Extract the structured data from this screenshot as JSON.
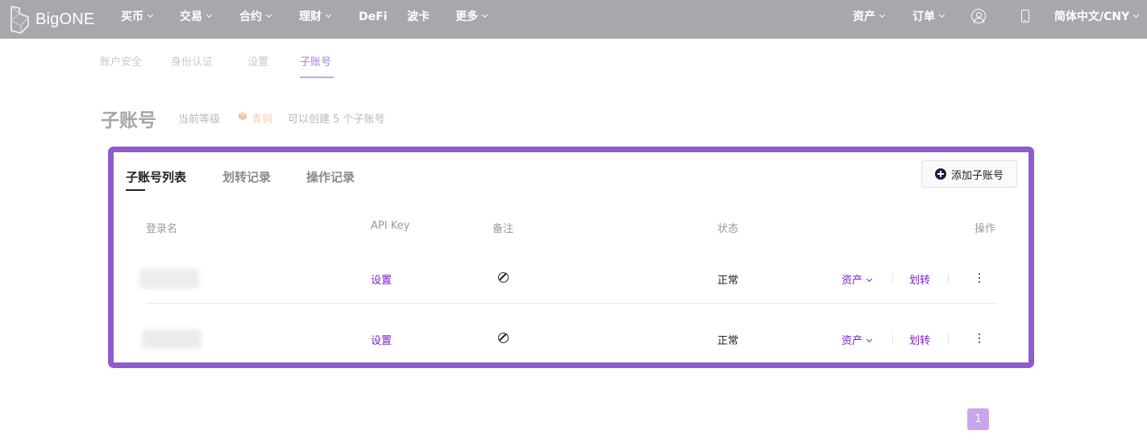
{
  "brand": {
    "name": "BigONE"
  },
  "topnav": {
    "left": [
      {
        "label": "买币",
        "dropdown": true
      },
      {
        "label": "交易",
        "dropdown": true
      },
      {
        "label": "合约",
        "dropdown": true
      },
      {
        "label": "理财",
        "dropdown": true
      },
      {
        "label": "DeFi",
        "dropdown": false
      },
      {
        "label": "波卡",
        "dropdown": false
      },
      {
        "label": "更多",
        "dropdown": true
      }
    ],
    "right": [
      {
        "label": "资产",
        "dropdown": true
      },
      {
        "label": "订单",
        "dropdown": true
      }
    ],
    "language": "简体中文/CNY",
    "icons": [
      "user-icon",
      "phone-icon"
    ]
  },
  "subnav": [
    {
      "label": "账户安全",
      "active": false
    },
    {
      "label": "身份认证",
      "active": false
    },
    {
      "label": "设置",
      "active": false
    },
    {
      "label": "子账号",
      "active": true
    }
  ],
  "page": {
    "title": "子账号",
    "level_label": "当前等级",
    "level_name": "青铜",
    "level_note": "可以创建 5 个子账号"
  },
  "tabs": [
    {
      "label": "子账号列表",
      "active": true
    },
    {
      "label": "划转记录",
      "active": false
    },
    {
      "label": "操作记录",
      "active": false
    }
  ],
  "add_button": {
    "label": "添加子账号"
  },
  "table": {
    "headers": {
      "login": "登录名",
      "api_key": "API Key",
      "remark": "备注",
      "status": "状态",
      "actions": "操作"
    },
    "rows": [
      {
        "api_key": "设置",
        "status": "正常",
        "asset": "资产",
        "transfer": "划转"
      },
      {
        "api_key": "设置",
        "status": "正常",
        "asset": "资产",
        "transfer": "划转"
      }
    ]
  },
  "pagination": {
    "current": "1"
  },
  "colors": {
    "accent": "#8f5bd0",
    "link": "#7a1fc9",
    "topbar": "#a8a8ac"
  }
}
